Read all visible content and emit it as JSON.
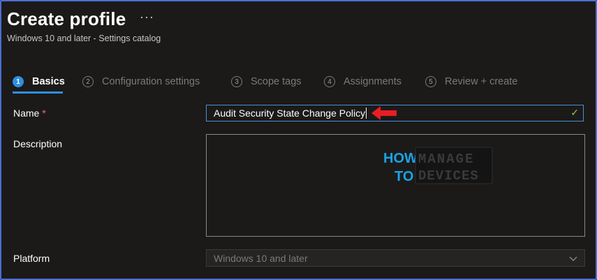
{
  "header": {
    "title": "Create profile",
    "more_label": "···",
    "subtitle": "Windows 10 and later - Settings catalog"
  },
  "steps": [
    {
      "num": "1",
      "label": "Basics",
      "active": true
    },
    {
      "num": "2",
      "label": "Configuration settings",
      "active": false
    },
    {
      "num": "3",
      "label": "Scope tags",
      "active": false
    },
    {
      "num": "4",
      "label": "Assignments",
      "active": false
    },
    {
      "num": "5",
      "label": "Review + create",
      "active": false
    }
  ],
  "form": {
    "name_label": "Name",
    "required_mark": "*",
    "name_value": "Audit Security State Change Policy",
    "description_label": "Description",
    "description_value": "",
    "platform_label": "Platform",
    "platform_value": "Windows 10 and later"
  },
  "watermark": {
    "how": "HOW",
    "to": "TO",
    "manage": "MANAGE",
    "devices": "DEVICES"
  },
  "icons": {
    "valid": "check-icon",
    "pointer": "red-arrow-icon",
    "dropdown": "chevron-down-icon"
  },
  "colors": {
    "accent": "#2f8fe0",
    "valid": "#92c353",
    "required": "#f1707b",
    "arrow": "#e81e25"
  }
}
